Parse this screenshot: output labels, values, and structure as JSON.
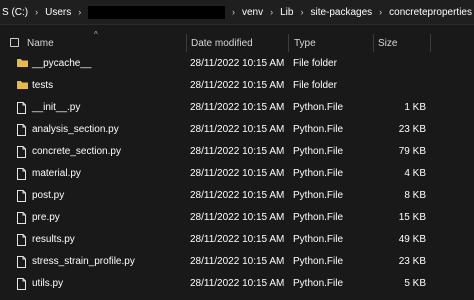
{
  "breadcrumb": {
    "items": [
      {
        "label": "S (C:)"
      },
      {
        "label": "Users"
      },
      {
        "label": ""
      },
      {
        "label": "venv"
      },
      {
        "label": "Lib"
      },
      {
        "label": "site-packages"
      },
      {
        "label": "concreteproperties"
      }
    ],
    "separator": "›"
  },
  "columns": {
    "name": "Name",
    "date_modified": "Date modified",
    "type": "Type",
    "size": "Size"
  },
  "sort_indicator": "^",
  "files": [
    {
      "name": "__pycache__",
      "date": "28/11/2022 10:15 AM",
      "type": "File folder",
      "size": "",
      "icon": "folder-icon"
    },
    {
      "name": "tests",
      "date": "28/11/2022 10:15 AM",
      "type": "File folder",
      "size": "",
      "icon": "folder-icon"
    },
    {
      "name": "__init__.py",
      "date": "28/11/2022 10:15 AM",
      "type": "Python.File",
      "size": "1 KB",
      "icon": "file-icon"
    },
    {
      "name": "analysis_section.py",
      "date": "28/11/2022 10:15 AM",
      "type": "Python.File",
      "size": "23 KB",
      "icon": "file-icon"
    },
    {
      "name": "concrete_section.py",
      "date": "28/11/2022 10:15 AM",
      "type": "Python.File",
      "size": "79 KB",
      "icon": "file-icon"
    },
    {
      "name": "material.py",
      "date": "28/11/2022 10:15 AM",
      "type": "Python.File",
      "size": "4 KB",
      "icon": "file-icon"
    },
    {
      "name": "post.py",
      "date": "28/11/2022 10:15 AM",
      "type": "Python.File",
      "size": "8 KB",
      "icon": "file-icon"
    },
    {
      "name": "pre.py",
      "date": "28/11/2022 10:15 AM",
      "type": "Python.File",
      "size": "15 KB",
      "icon": "file-icon"
    },
    {
      "name": "results.py",
      "date": "28/11/2022 10:15 AM",
      "type": "Python.File",
      "size": "49 KB",
      "icon": "file-icon"
    },
    {
      "name": "stress_strain_profile.py",
      "date": "28/11/2022 10:15 AM",
      "type": "Python.File",
      "size": "23 KB",
      "icon": "file-icon"
    },
    {
      "name": "utils.py",
      "date": "28/11/2022 10:15 AM",
      "type": "Python.File",
      "size": "5 KB",
      "icon": "file-icon"
    }
  ],
  "colors": {
    "background": "#191919",
    "text": "#ffffff",
    "folder": "#e8b84a"
  }
}
